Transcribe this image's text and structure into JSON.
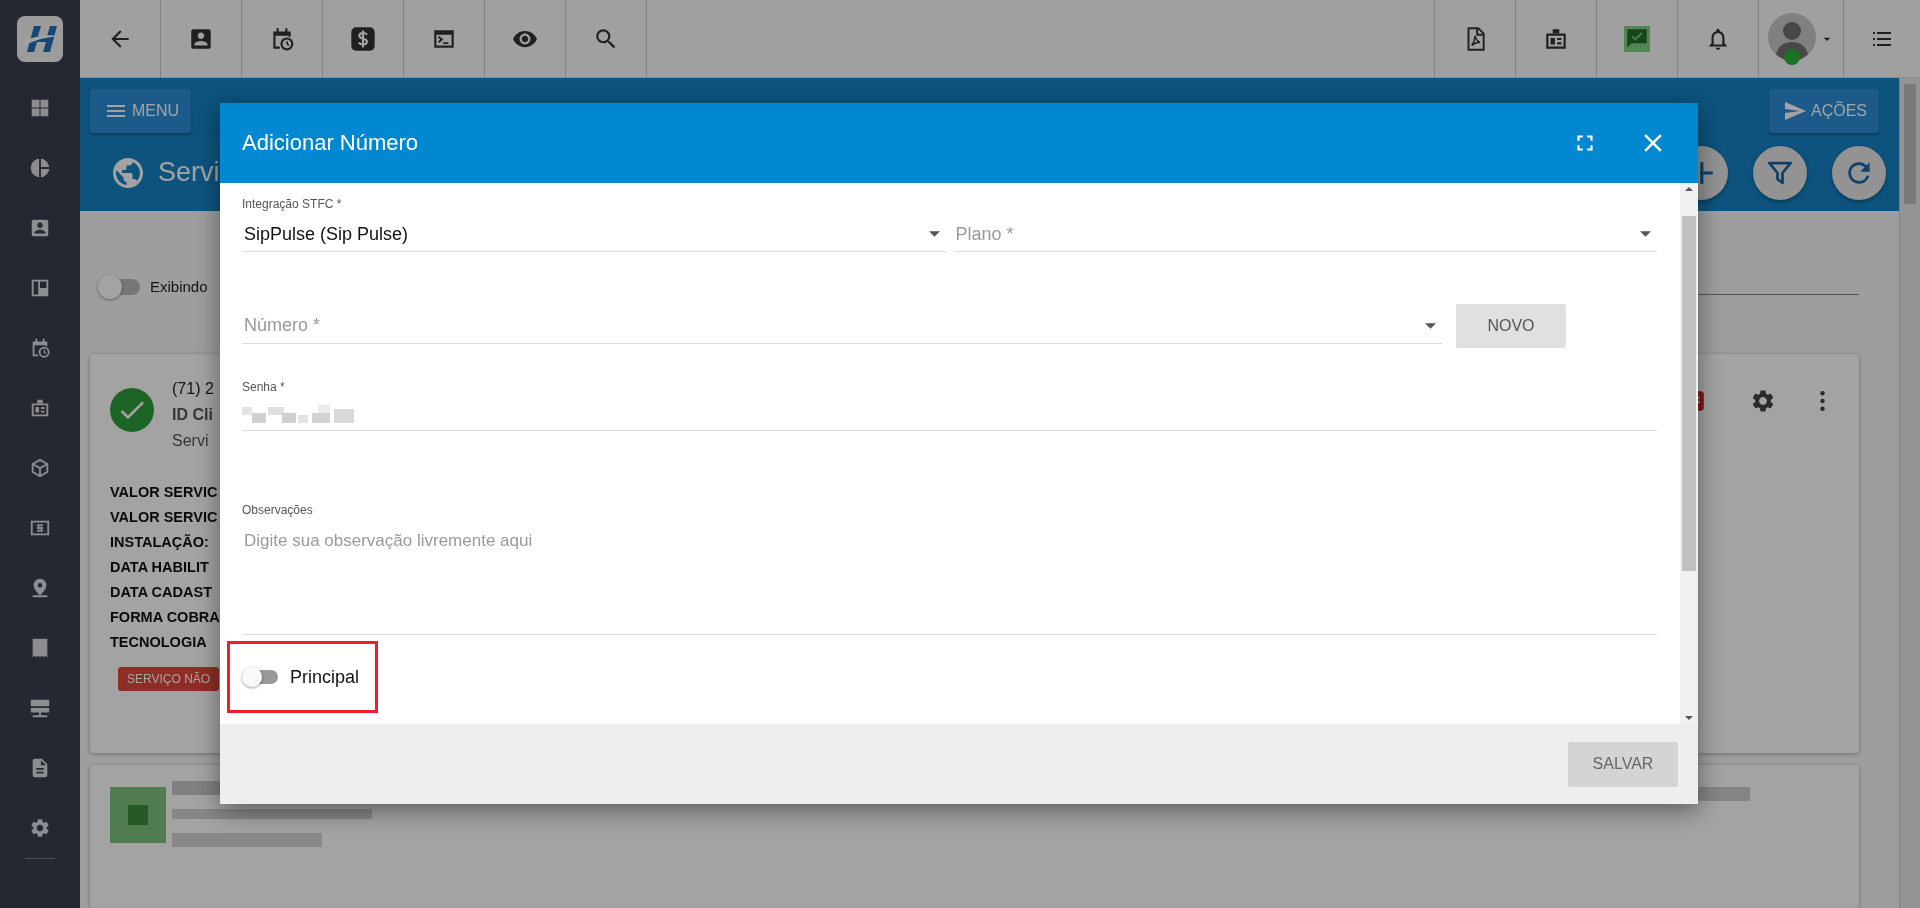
{
  "header": {
    "menu_button": "MENU",
    "actions_button": "AÇÕES"
  },
  "page_title": "Servi",
  "display_toggle": {
    "label": "Exibindo",
    "on": false
  },
  "service_card": {
    "phone": "(71) 2",
    "id_label": "ID Cli",
    "service_label": "Servi",
    "details": [
      "VALOR SERVIC",
      "VALOR SERVIC",
      "INSTALAÇÃO:",
      "DATA HABILIT",
      "DATA CADAST",
      "FORMA COBRA",
      "TECNOLOGIA"
    ],
    "status_badge": "SERVIÇO NÃO"
  },
  "dialog": {
    "title": "Adicionar Número",
    "fields": [
      {
        "kind": "select",
        "label": "Integração STFC *",
        "value": "SipPulse (Sip Pulse)"
      },
      {
        "kind": "select",
        "placeholder": "Plano *"
      },
      {
        "kind": "select",
        "placeholder": "Número *"
      },
      {
        "kind": "password",
        "label": "Senha *"
      },
      {
        "kind": "textarea",
        "label": "Observações",
        "placeholder": "Digite sua observação livremente aqui"
      }
    ],
    "new_button": {
      "label": "NOVO",
      "disabled": true
    },
    "principal": {
      "label": "Principal",
      "on": false,
      "highlighted": true
    },
    "save_button": {
      "label": "SALVAR",
      "disabled": true
    }
  }
}
